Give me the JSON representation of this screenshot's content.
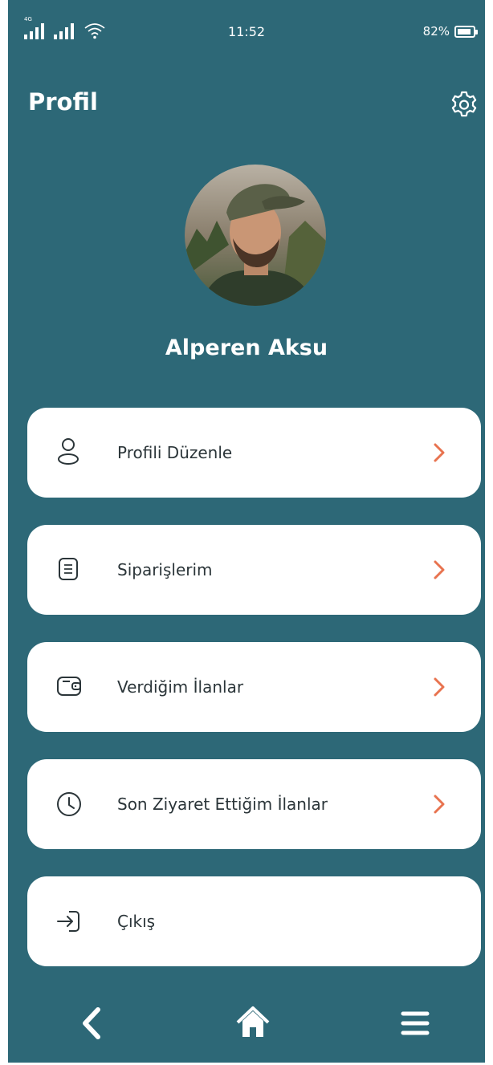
{
  "status_bar": {
    "network_tag": "4G",
    "time": "11:52",
    "battery_percent": "82%",
    "battery_level": 0.82,
    "icons": [
      "signal-icon",
      "signal-icon",
      "wifi-icon",
      "battery-icon"
    ]
  },
  "header": {
    "title": "Profil",
    "settings_icon": "gear-icon"
  },
  "profile": {
    "name": "Alperen Aksu"
  },
  "menu": [
    {
      "label": "Profili Düzenle",
      "icon": "user-icon",
      "has_arrow": true
    },
    {
      "label": "Siparişlerim",
      "icon": "document-icon",
      "has_arrow": true
    },
    {
      "label": "Verdiğim İlanlar",
      "icon": "wallet-icon",
      "has_arrow": true
    },
    {
      "label": "Son Ziyaret Ettiğim İlanlar",
      "icon": "clock-icon",
      "has_arrow": true
    },
    {
      "label": "Çıkış",
      "icon": "logout-icon",
      "has_arrow": false
    }
  ],
  "bottom_nav": {
    "icons": [
      "back-icon",
      "home-icon",
      "menu-icon"
    ]
  },
  "colors": {
    "background": "#2d6877",
    "card": "#ffffff",
    "accent_arrow": "#e8734f",
    "text": "#2b3539"
  }
}
